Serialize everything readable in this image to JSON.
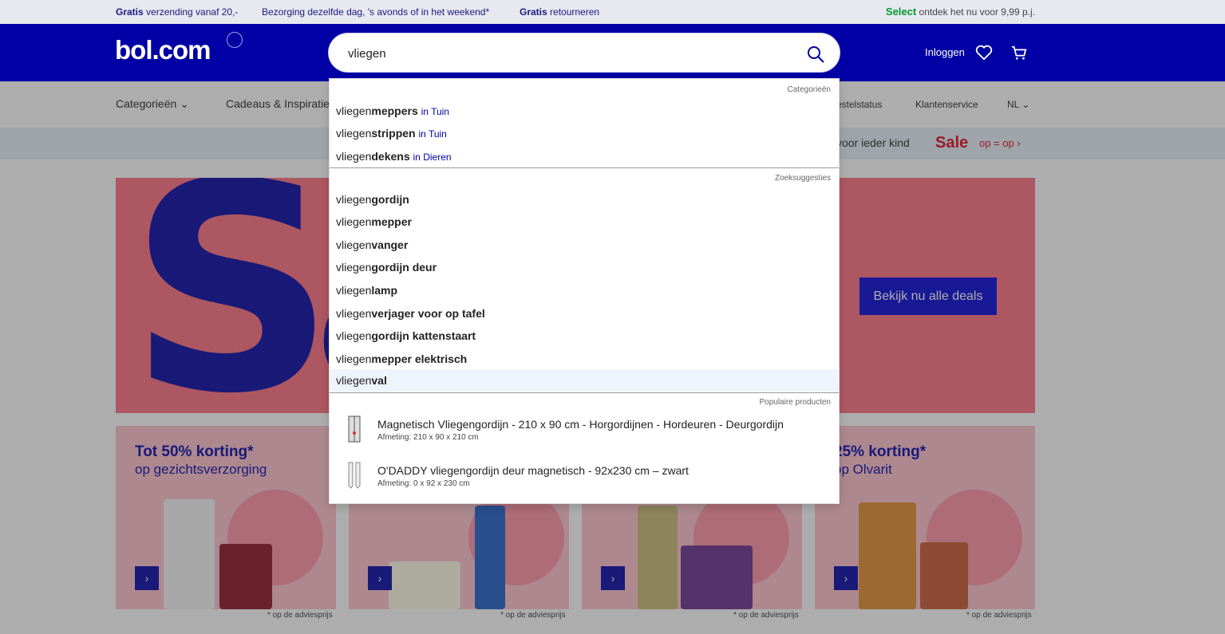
{
  "usp": {
    "item1_bold": "Gratis",
    "item1_text": " verzending vanaf 20,-",
    "item2_text": "Bezorging dezelfde dag, 's avonds of in het weekend*",
    "item3_bold": "Gratis",
    "item3_text": " retourneren",
    "select_bold": "Select",
    "select_text": " ontdek het nu voor 9,99 p.j."
  },
  "header": {
    "logo": "bol.com",
    "login": "Inloggen",
    "heart_icon": "heart-icon",
    "cart_icon": "cart-icon"
  },
  "search": {
    "value": "vliegen",
    "icon": "search-icon"
  },
  "nav": {
    "categories": "Categorieën",
    "gifts": "Cadeaus & Inspiratie",
    "order_status": "Bestelstatus",
    "customer_service": "Klantenservice",
    "language": "NL"
  },
  "subnav": {
    "kids": "voor ieder kind",
    "sale": "Sale",
    "sale_sub": "op = op"
  },
  "hero": {
    "big_text": "Sa",
    "button": "Bekijk nu alle deals"
  },
  "cards": [
    {
      "title": "Tot 50% korting*",
      "sub": "op gezichtsverzorging",
      "footnote": "* op de adviesprijs"
    },
    {
      "title": "",
      "sub": "",
      "footnote": "* op de adviesprijs"
    },
    {
      "title": "",
      "sub": "",
      "footnote": "* op de adviesprijs"
    },
    {
      "title": "25% korting*",
      "sub": "op Olvarit",
      "footnote": "* op de adviesprijs"
    }
  ],
  "dropdown": {
    "categories_head": "Categorieën",
    "categories": [
      {
        "prefix": "vliegen",
        "bold": "meppers",
        "in": "in Tuin"
      },
      {
        "prefix": "vliegen",
        "bold": "strippen",
        "in": "in Tuin"
      },
      {
        "prefix": "vliegen",
        "bold": "dekens",
        "in": "in Dieren"
      }
    ],
    "suggestions_head": "Zoeksuggesties",
    "suggestions": [
      {
        "prefix": "vliegen",
        "bold": "gordijn"
      },
      {
        "prefix": "vliegen",
        "bold": "mepper"
      },
      {
        "prefix": "vliegen",
        "bold": "vanger"
      },
      {
        "prefix": "vliegen",
        "bold": "gordijn deur"
      },
      {
        "prefix": "vliegen",
        "bold": "lamp"
      },
      {
        "prefix": "vliegen",
        "bold": "verjager voor op tafel"
      },
      {
        "prefix": "vliegen",
        "bold": "gordijn kattenstaart"
      },
      {
        "prefix": "vliegen",
        "bold": "mepper elektrisch"
      },
      {
        "prefix": "vliegen",
        "bold": "val"
      }
    ],
    "products_head": "Populaire producten",
    "products": [
      {
        "name": "Magnetisch Vliegengordijn - 210 x 90 cm - Horgordijnen - Hordeuren - Deurgordijn",
        "meta": "Afmeting: 210 x 90 x 210 cm"
      },
      {
        "name": "O'DADDY vliegengordijn deur magnetisch - 92x230 cm – zwart",
        "meta": "Afmeting: 0 x 92 x 230 cm"
      }
    ]
  },
  "colors": {
    "brand_blue": "#0000a4",
    "sale_red": "#e0001b",
    "select_green": "#009a2e",
    "hero_pink": "#ff6b7e"
  }
}
